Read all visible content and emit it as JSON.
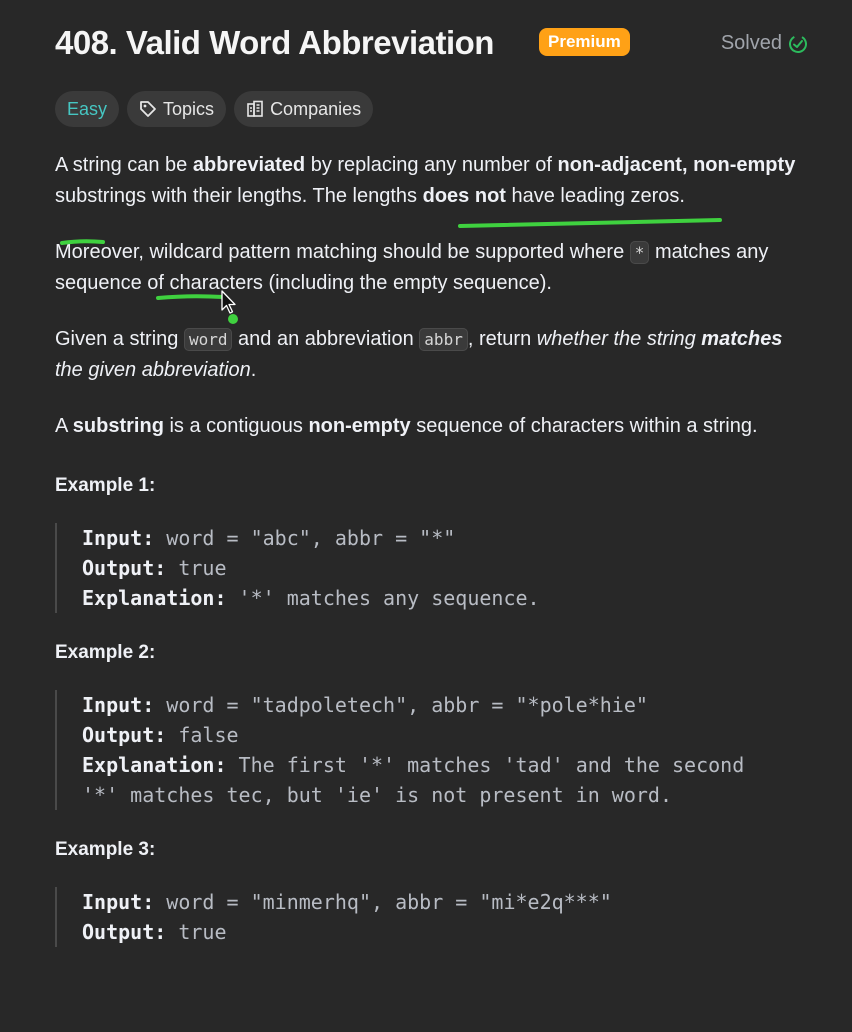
{
  "problem": {
    "title": "408. Valid Word Abbreviation",
    "premium_badge": "Premium",
    "status": "Solved",
    "difficulty": "Easy",
    "topics_label": "Topics",
    "companies_label": "Companies"
  },
  "description": {
    "p1": {
      "t1": "A string can be ",
      "b1": "abbreviated",
      "t2": " by replacing any number of ",
      "b2": "non-adjacent",
      "t3": ", ",
      "b3": "non-empty",
      "t4": " substrings with their lengths. The lengths ",
      "b4": "does not",
      "t5": " have leading zeros."
    },
    "p2": {
      "t1": "Moreover, wildcard pattern matching should be supported where ",
      "code": "*",
      "t2": " matches any sequence of characters (including the empty sequence)."
    },
    "p3": {
      "t1": "Given a string ",
      "code1": "word",
      "t2": " and an abbreviation ",
      "code2": "abbr",
      "t3": ", return ",
      "i1": "whether the string ",
      "bi": "matches",
      "i2": " the given abbreviation",
      "t4": "."
    },
    "p4": {
      "t1": "A ",
      "b1": "substring",
      "t2": " is a contiguous ",
      "b2": "non-empty",
      "t3": " sequence of characters within a string."
    }
  },
  "examples": [
    {
      "title": "Example 1:",
      "input_label": "Input:",
      "input": " word = \"abc\", abbr = \"*\"",
      "output_label": "Output:",
      "output": " true",
      "explanation_label": "Explanation:",
      "explanation": " '*' matches any sequence."
    },
    {
      "title": "Example 2:",
      "input_label": "Input:",
      "input": " word = \"tadpoletech\", abbr = \"*pole*hie\"",
      "output_label": "Output:",
      "output": " false",
      "explanation_label": "Explanation:",
      "explanation": " The first '*' matches 'tad' and the second\n'*' matches tec, but 'ie' is not present in word."
    },
    {
      "title": "Example 3:",
      "input_label": "Input:",
      "input": " word = \"minmerhq\", abbr = \"mi*e2q***\"",
      "output_label": "Output:",
      "output": " true"
    }
  ],
  "colors": {
    "background": "#282828",
    "premium": "#ffa116",
    "easy": "#46c6c2",
    "solved_check": "#2cbb5d",
    "annotation": "#3fd13f"
  },
  "icons": [
    "check-circle-icon",
    "tag-icon",
    "building-icon",
    "cursor-icon"
  ]
}
